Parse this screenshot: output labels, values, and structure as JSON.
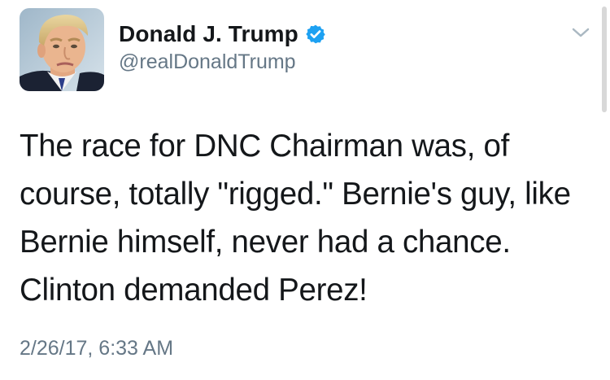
{
  "tweet": {
    "author": {
      "display_name": "Donald J. Trump",
      "handle": "@realDonaldTrump",
      "verified": true,
      "avatar_icon": "profile-photo"
    },
    "text": "The race for DNC Chairman was, of course, totally \"rigged.\" Bernie's guy, like Bernie himself, never had a chance. Clinton demanded Perez!",
    "timestamp": "2/26/17, 6:33 AM",
    "menu_icon": "chevron-down-icon"
  },
  "colors": {
    "verified_badge": "#1da1f2",
    "secondary_text": "#657786",
    "primary_text": "#14171a",
    "chevron": "#aab8c2"
  }
}
